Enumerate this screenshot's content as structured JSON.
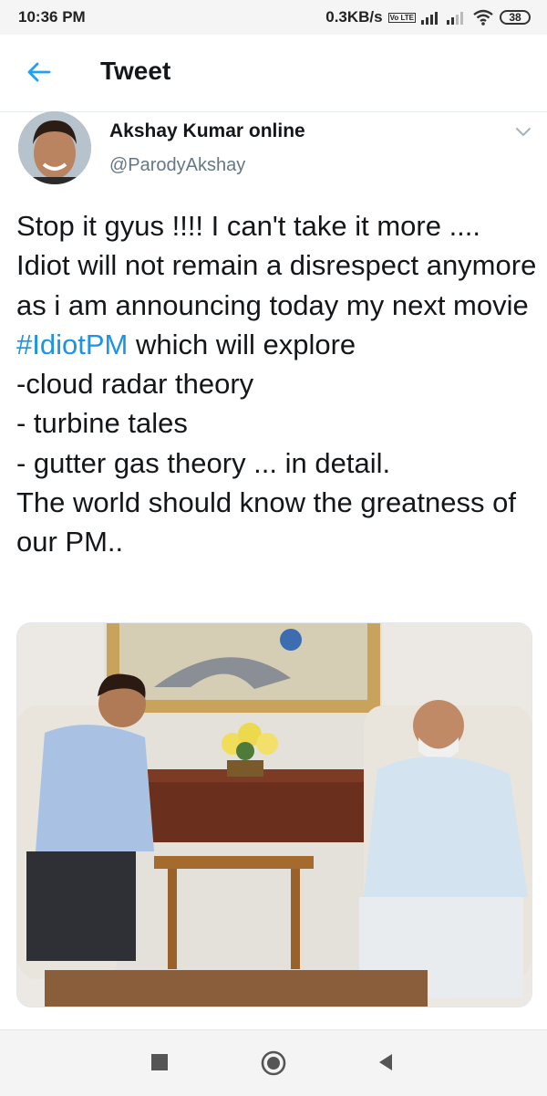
{
  "status_bar": {
    "time": "10:36 PM",
    "data_speed": "0.3KB/s",
    "volte": "Vo LTE",
    "battery": "38"
  },
  "header": {
    "title": "Tweet",
    "back_icon": "arrow-left-icon"
  },
  "tweet": {
    "author_name": "Akshay Kumar online",
    "author_handle": "@ParodyAkshay",
    "text_before": "Stop it gyus !!!! I can't take it more .... Idiot will not remain a disrespect anymore as i am announcing today my next movie ",
    "hashtag": "#IdiotPM",
    "text_after": " which will explore\n-cloud radar theory\n- turbine tales\n- gutter gas theory ... in detail.\nThe world should know the greatness of our PM..",
    "hashtag_color": "#1b95e0"
  },
  "nav_bar": {
    "icons": [
      "recents-square-icon",
      "home-circle-icon",
      "back-triangle-icon"
    ]
  }
}
